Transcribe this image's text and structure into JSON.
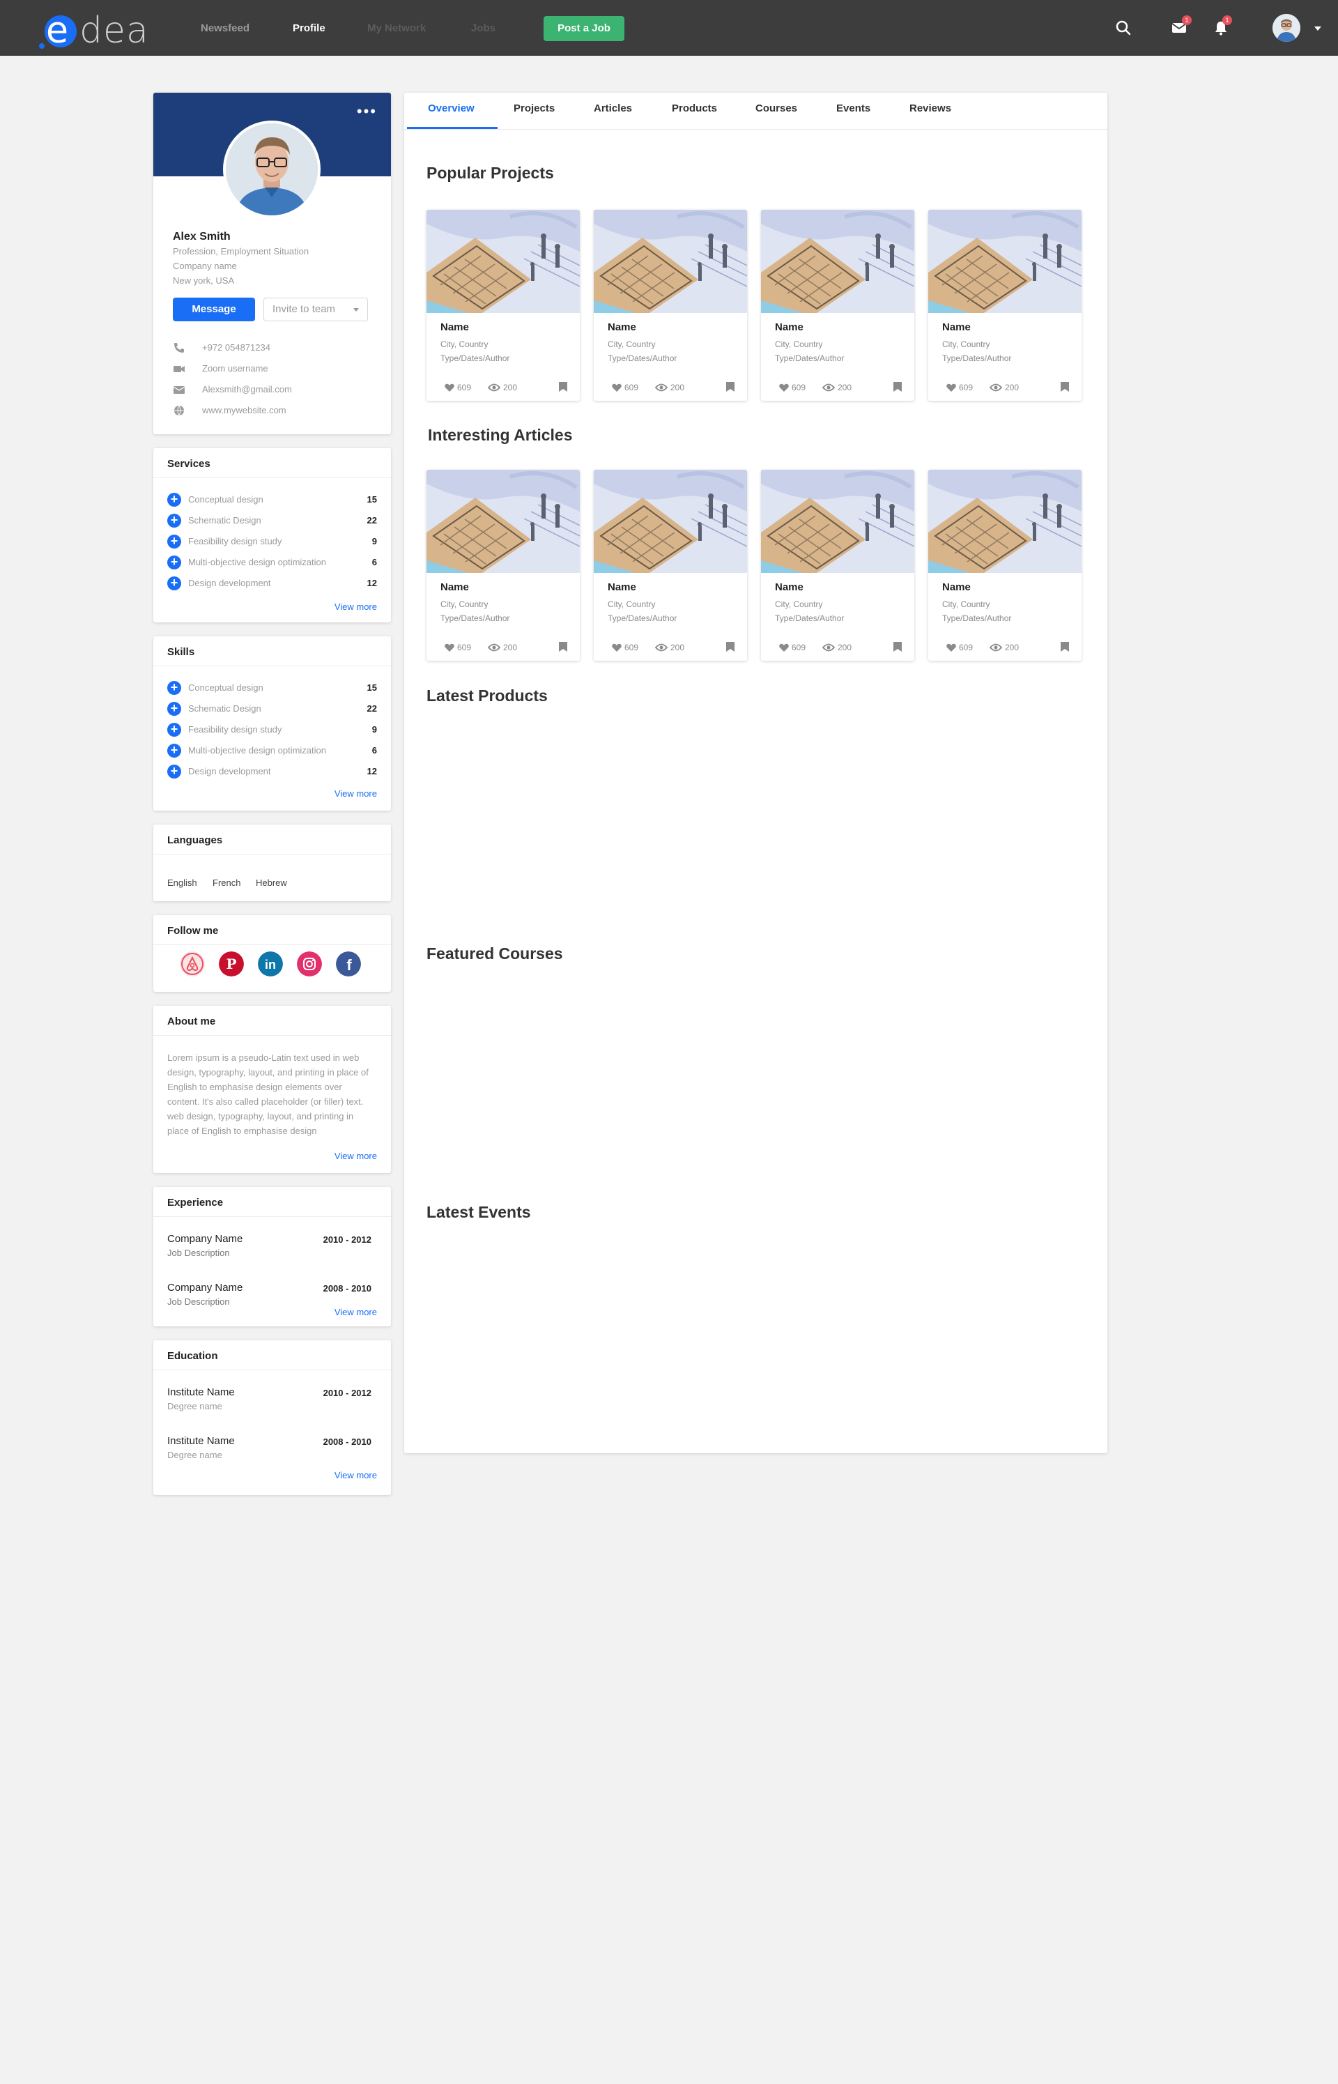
{
  "topbar": {
    "logo_e": "e",
    "logo_rest": "dea",
    "nav": [
      "Newsfeed",
      "Profile",
      "My Network",
      "Jobs"
    ],
    "post_job_label": "Post a Job",
    "messages_badge": "1",
    "notifications_badge": "1"
  },
  "profile": {
    "name": "Alex Smith",
    "profession": "Profession, Employment Situation",
    "company": "Company name",
    "location": "New york, USA",
    "message_label": "Message",
    "invite_label": "Invite to team",
    "more_label": "•••",
    "contacts": [
      {
        "icon": "phone-icon",
        "text": "+972 054871234"
      },
      {
        "icon": "video-icon",
        "text": "Zoom username"
      },
      {
        "icon": "mail-icon",
        "text": "Alexsmith@gmail.com"
      },
      {
        "icon": "globe-icon",
        "text": "www.mywebsite.com"
      }
    ]
  },
  "services": {
    "title": "Services",
    "items": [
      {
        "label": "Conceptual design",
        "count": "15"
      },
      {
        "label": "Schematic Design",
        "count": "22"
      },
      {
        "label": "Feasibility design study",
        "count": "9"
      },
      {
        "label": "Multi-objective design optimization",
        "count": "6"
      },
      {
        "label": "Design development",
        "count": "12"
      }
    ],
    "view_more": "View more"
  },
  "skills": {
    "title": "Skills",
    "items": [
      {
        "label": "Conceptual design",
        "count": "15"
      },
      {
        "label": "Schematic Design",
        "count": "22"
      },
      {
        "label": "Feasibility design study",
        "count": "9"
      },
      {
        "label": "Multi-objective design optimization",
        "count": "6"
      },
      {
        "label": "Design development",
        "count": "12"
      }
    ],
    "view_more": "View more"
  },
  "languages": {
    "title": "Languages",
    "items": [
      "English",
      "French",
      "Hebrew"
    ]
  },
  "follow": {
    "title": "Follow me",
    "networks": [
      "airbnb-icon",
      "pinterest-icon",
      "linkedin-icon",
      "instagram-icon",
      "facebook-icon"
    ],
    "linkedin_text": "in",
    "facebook_text": "f",
    "pinterest_text": "P"
  },
  "about": {
    "title": "About me",
    "text": "Lorem ipsum is a pseudo-Latin text used in web design, typography, layout, and printing in place of English to emphasise design elements over content. It's also called placeholder (or filler) text. web design, typography, layout, and printing in place of English to emphasise design",
    "view_more": "View more"
  },
  "experience": {
    "title": "Experience",
    "items": [
      {
        "company": "Company Name",
        "desc": "Job Description",
        "dates": "2010 - 2012"
      },
      {
        "company": "Company Name",
        "desc": "Job Description",
        "dates": "2008 - 2010"
      }
    ],
    "view_more": "View more"
  },
  "education": {
    "title": "Education",
    "items": [
      {
        "institute": "Institute Name",
        "degree": "Degree name",
        "dates": "2010 - 2012"
      },
      {
        "institute": "Institute Name",
        "degree": "Degree name",
        "dates": "2008 - 2010"
      }
    ],
    "view_more": "View more"
  },
  "tabs": [
    "Overview",
    "Projects",
    "Articles",
    "Products",
    "Courses",
    "Events",
    "Reviews"
  ],
  "sections": {
    "popular_projects": "Popular Projects",
    "interesting_articles": "Interesting Articles",
    "latest_products": "Latest Products",
    "featured_courses": "Featured Courses",
    "latest_events": "Latest Events"
  },
  "card_template": {
    "name": "Name",
    "location": "City, Country",
    "meta": "Type/Dates/Author",
    "likes": "609",
    "views": "200"
  },
  "colors": {
    "accent": "#1a6ef5",
    "topbar": "#3d3d3d",
    "banner": "#1e3d7b",
    "post_job": "#3cb371"
  }
}
